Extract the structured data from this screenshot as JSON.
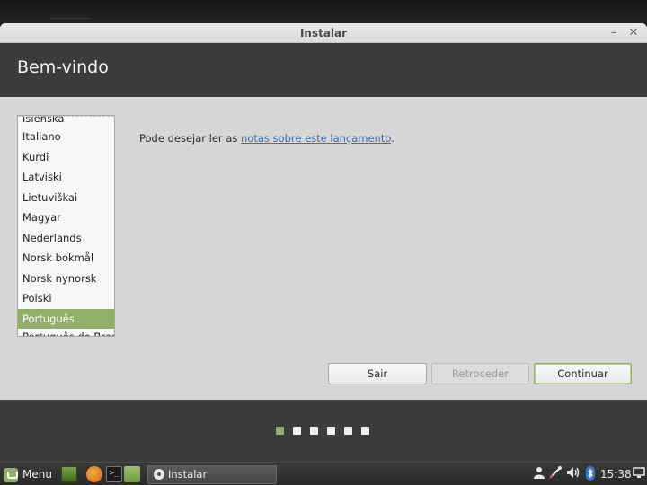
{
  "window": {
    "title": "Instalar",
    "minimize_glyph": "–",
    "close_glyph": "✕"
  },
  "header": {
    "title": "Bem-vindo"
  },
  "language_list": {
    "items": [
      {
        "label": "Íslenska",
        "state": "cut-top"
      },
      {
        "label": "Italiano"
      },
      {
        "label": "Kurdî"
      },
      {
        "label": "Latviski"
      },
      {
        "label": "Lietuviškai"
      },
      {
        "label": "Magyar"
      },
      {
        "label": "Nederlands"
      },
      {
        "label": "Norsk bokmål"
      },
      {
        "label": "Norsk nynorsk"
      },
      {
        "label": "Polski"
      },
      {
        "label": "Português",
        "state": "selected"
      },
      {
        "label": "Português do Brasil",
        "state": "cut-bottom"
      }
    ]
  },
  "release_note": {
    "prefix": "Pode desejar ler as ",
    "link_text": "notas sobre este lançamento",
    "suffix": "."
  },
  "buttons": {
    "quit": "Sair",
    "back": "Retroceder",
    "continue": "Continuar"
  },
  "progress": {
    "total_steps": 6,
    "current_step": 1
  },
  "taskbar": {
    "menu_label": "Menu",
    "task_label": "Instalar",
    "clock": "15:38",
    "terminal_glyph": ">_"
  },
  "colors": {
    "accent": "#8fb069",
    "header_bg": "#3c3c3c",
    "window_bg": "#d6d6d6",
    "link": "#3b6fb6"
  },
  "icons": {
    "desktop": "show-desktop-icon",
    "firefox": "firefox-icon",
    "terminal": "terminal-icon",
    "files": "files-icon",
    "user": "user-icon",
    "network": "network-icon",
    "volume": "volume-icon",
    "bluetooth": "bluetooth-icon",
    "screen": "screen-icon"
  }
}
